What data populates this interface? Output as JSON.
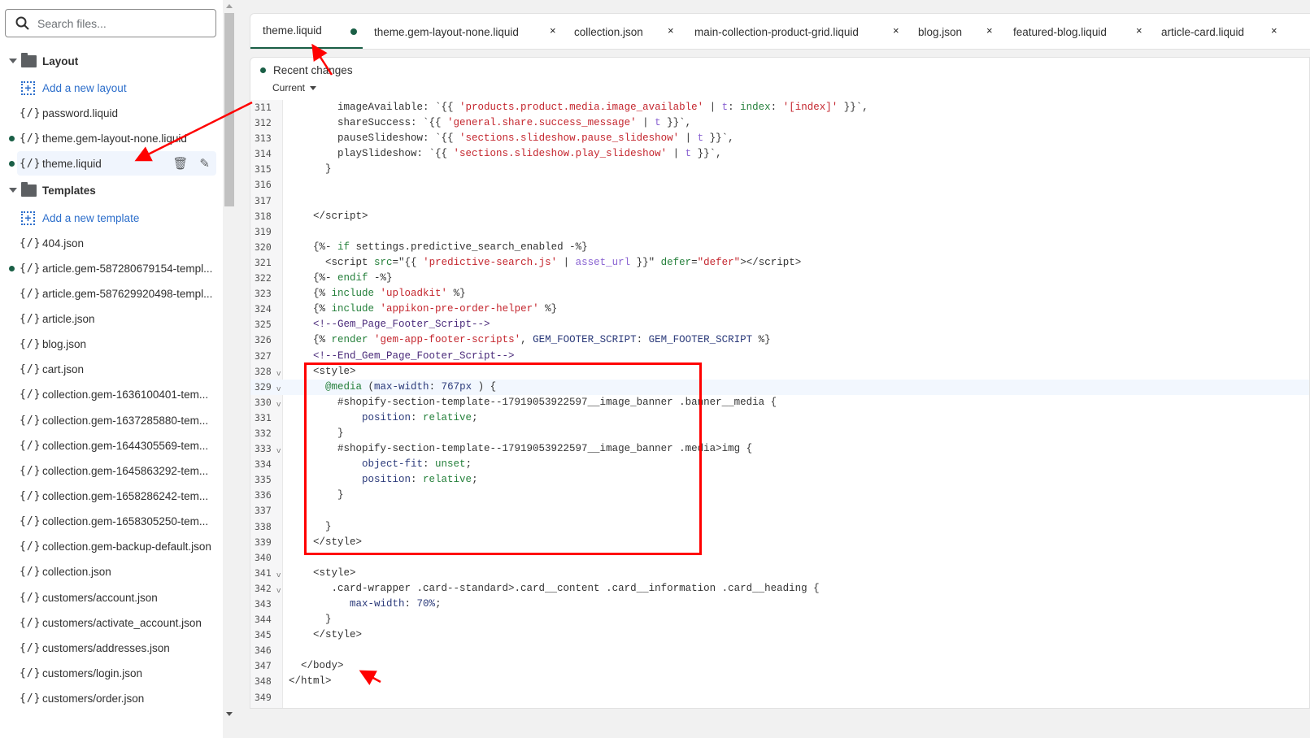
{
  "sidebar": {
    "search_placeholder": "Search files...",
    "items": [
      {
        "type": "folder",
        "label": "Layout"
      },
      {
        "type": "add",
        "label": "Add a new layout"
      },
      {
        "type": "file",
        "label": "password.liquid"
      },
      {
        "type": "file",
        "label": "theme.gem-layout-none.liquid",
        "modified": true
      },
      {
        "type": "file",
        "label": "theme.liquid",
        "modified": true,
        "selected": true
      },
      {
        "type": "folder",
        "label": "Templates"
      },
      {
        "type": "add",
        "label": "Add a new template"
      },
      {
        "type": "file",
        "label": "404.json"
      },
      {
        "type": "file",
        "label": "article.gem-587280679154-templ...",
        "modified": true
      },
      {
        "type": "file",
        "label": "article.gem-587629920498-templ..."
      },
      {
        "type": "file",
        "label": "article.json"
      },
      {
        "type": "file",
        "label": "blog.json"
      },
      {
        "type": "file",
        "label": "cart.json"
      },
      {
        "type": "file",
        "label": "collection.gem-1636100401-tem..."
      },
      {
        "type": "file",
        "label": "collection.gem-1637285880-tem..."
      },
      {
        "type": "file",
        "label": "collection.gem-1644305569-tem..."
      },
      {
        "type": "file",
        "label": "collection.gem-1645863292-tem..."
      },
      {
        "type": "file",
        "label": "collection.gem-1658286242-tem..."
      },
      {
        "type": "file",
        "label": "collection.gem-1658305250-tem..."
      },
      {
        "type": "file",
        "label": "collection.gem-backup-default.json"
      },
      {
        "type": "file",
        "label": "collection.json"
      },
      {
        "type": "file",
        "label": "customers/account.json"
      },
      {
        "type": "file",
        "label": "customers/activate_account.json"
      },
      {
        "type": "file",
        "label": "customers/addresses.json"
      },
      {
        "type": "file",
        "label": "customers/login.json"
      },
      {
        "type": "file",
        "label": "customers/order.json"
      }
    ],
    "file_icon": "{/}"
  },
  "tabs": [
    {
      "label": "theme.liquid",
      "active": true,
      "modified": true
    },
    {
      "label": "theme.gem-layout-none.liquid"
    },
    {
      "label": "collection.json"
    },
    {
      "label": "main-collection-product-grid.liquid"
    },
    {
      "label": "blog.json"
    },
    {
      "label": "featured-blog.liquid"
    },
    {
      "label": "article-card.liquid"
    }
  ],
  "editor": {
    "recent_changes": "Recent changes",
    "version_select": "Current",
    "highlighted_line": 329,
    "folds": [
      328,
      329,
      330,
      333,
      341,
      342
    ],
    "lines": [
      {
        "n": 311,
        "t": [
          [
            "p",
            "        imageAvailable: `{{ "
          ],
          [
            "s",
            "'products.product.media.image_available'"
          ],
          [
            "p",
            " | "
          ],
          [
            "f",
            "t"
          ],
          [
            "p",
            ": "
          ],
          [
            "k",
            "index"
          ],
          [
            "p",
            ": "
          ],
          [
            "s",
            "'[index]'"
          ],
          [
            "p",
            " }}`,"
          ]
        ]
      },
      {
        "n": 312,
        "t": [
          [
            "p",
            "        shareSuccess: `{{ "
          ],
          [
            "s",
            "'general.share.success_message'"
          ],
          [
            "p",
            " | "
          ],
          [
            "f",
            "t"
          ],
          [
            "p",
            " }}`,"
          ]
        ]
      },
      {
        "n": 313,
        "t": [
          [
            "p",
            "        pauseSlideshow: `{{ "
          ],
          [
            "s",
            "'sections.slideshow.pause_slideshow'"
          ],
          [
            "p",
            " | "
          ],
          [
            "f",
            "t"
          ],
          [
            "p",
            " }}`,"
          ]
        ]
      },
      {
        "n": 314,
        "t": [
          [
            "p",
            "        playSlideshow: `{{ "
          ],
          [
            "s",
            "'sections.slideshow.play_slideshow'"
          ],
          [
            "p",
            " | "
          ],
          [
            "f",
            "t"
          ],
          [
            "p",
            " }}`,"
          ]
        ]
      },
      {
        "n": 315,
        "t": [
          [
            "p",
            "      }"
          ]
        ]
      },
      {
        "n": 316,
        "t": []
      },
      {
        "n": 317,
        "t": []
      },
      {
        "n": 318,
        "t": [
          [
            "p",
            "    </script>"
          ]
        ]
      },
      {
        "n": 319,
        "t": []
      },
      {
        "n": 320,
        "t": [
          [
            "p",
            "    {%- "
          ],
          [
            "k",
            "if"
          ],
          [
            "p",
            " settings.predictive_search_enabled -%}"
          ]
        ]
      },
      {
        "n": 321,
        "t": [
          [
            "p",
            "      <script "
          ],
          [
            "k",
            "src"
          ],
          [
            "p",
            "=\"{{ "
          ],
          [
            "s",
            "'predictive-search.js'"
          ],
          [
            "p",
            " | "
          ],
          [
            "f",
            "asset_url"
          ],
          [
            "p",
            " }}\" "
          ],
          [
            "k",
            "defer"
          ],
          [
            "p",
            "="
          ],
          [
            "s",
            "\"defer\""
          ],
          [
            "p",
            "></script>"
          ]
        ]
      },
      {
        "n": 322,
        "t": [
          [
            "p",
            "    {%- "
          ],
          [
            "k",
            "endif"
          ],
          [
            "p",
            " -%}"
          ]
        ]
      },
      {
        "n": 323,
        "t": [
          [
            "p",
            "    {% "
          ],
          [
            "k",
            "include"
          ],
          [
            "p",
            " "
          ],
          [
            "s",
            "'uploadkit'"
          ],
          [
            "p",
            " %}"
          ]
        ]
      },
      {
        "n": 324,
        "t": [
          [
            "p",
            "    {% "
          ],
          [
            "k",
            "include"
          ],
          [
            "p",
            " "
          ],
          [
            "s",
            "'appikon-pre-order-helper'"
          ],
          [
            "p",
            " %}"
          ]
        ]
      },
      {
        "n": 325,
        "t": [
          [
            "c",
            "    <!--Gem_Page_Footer_Script-->"
          ]
        ]
      },
      {
        "n": 326,
        "t": [
          [
            "p",
            "    {% "
          ],
          [
            "k",
            "render"
          ],
          [
            "p",
            " "
          ],
          [
            "s",
            "'gem-app-footer-scripts'"
          ],
          [
            "p",
            ", "
          ],
          [
            "a",
            "GEM_FOOTER_SCRIPT"
          ],
          [
            "p",
            ": "
          ],
          [
            "a",
            "GEM_FOOTER_SCRIPT"
          ],
          [
            "p",
            " %}"
          ]
        ]
      },
      {
        "n": 327,
        "t": [
          [
            "c",
            "    <!--End_Gem_Page_Footer_Script-->"
          ]
        ]
      },
      {
        "n": 328,
        "t": [
          [
            "p",
            "    <style>"
          ]
        ]
      },
      {
        "n": 329,
        "t": [
          [
            "p",
            "      "
          ],
          [
            "k",
            "@media"
          ],
          [
            "p",
            " ("
          ],
          [
            "a",
            "max-width"
          ],
          [
            "p",
            ": "
          ],
          [
            "a",
            "767px"
          ],
          [
            "p",
            " ) {"
          ]
        ]
      },
      {
        "n": 330,
        "t": [
          [
            "p",
            "        #shopify-section-template--17919053922597__image_banner .banner__media {"
          ]
        ]
      },
      {
        "n": 331,
        "t": [
          [
            "a",
            "            position"
          ],
          [
            "p",
            ": "
          ],
          [
            "k",
            "relative"
          ],
          [
            "p",
            ";"
          ]
        ]
      },
      {
        "n": 332,
        "t": [
          [
            "p",
            "        }"
          ]
        ]
      },
      {
        "n": 333,
        "t": [
          [
            "p",
            "        #shopify-section-template--17919053922597__image_banner .media>img {"
          ]
        ]
      },
      {
        "n": 334,
        "t": [
          [
            "a",
            "            object-fit"
          ],
          [
            "p",
            ": "
          ],
          [
            "k",
            "unset"
          ],
          [
            "p",
            ";"
          ]
        ]
      },
      {
        "n": 335,
        "t": [
          [
            "a",
            "            position"
          ],
          [
            "p",
            ": "
          ],
          [
            "k",
            "relative"
          ],
          [
            "p",
            ";"
          ]
        ]
      },
      {
        "n": 336,
        "t": [
          [
            "p",
            "        }"
          ]
        ]
      },
      {
        "n": 337,
        "t": []
      },
      {
        "n": 338,
        "t": [
          [
            "p",
            "      }"
          ]
        ]
      },
      {
        "n": 339,
        "t": [
          [
            "p",
            "    </style>"
          ]
        ]
      },
      {
        "n": 340,
        "t": []
      },
      {
        "n": 341,
        "t": [
          [
            "p",
            "    <style>"
          ]
        ]
      },
      {
        "n": 342,
        "t": [
          [
            "p",
            "       .card-wrapper .card--standard>.card__content .card__information .card__heading {"
          ]
        ]
      },
      {
        "n": 343,
        "t": [
          [
            "a",
            "          max-width"
          ],
          [
            "p",
            ": "
          ],
          [
            "a",
            "70%"
          ],
          [
            "p",
            ";"
          ]
        ]
      },
      {
        "n": 344,
        "t": [
          [
            "p",
            "      }"
          ]
        ]
      },
      {
        "n": 345,
        "t": [
          [
            "p",
            "    </style>"
          ]
        ]
      },
      {
        "n": 346,
        "t": []
      },
      {
        "n": 347,
        "t": [
          [
            "p",
            "  </body>"
          ]
        ]
      },
      {
        "n": 348,
        "t": [
          [
            "p",
            "</html>"
          ]
        ]
      },
      {
        "n": 349,
        "t": []
      }
    ]
  },
  "annotation_color": "#ff0000",
  "accent_color": "#1a5f46"
}
